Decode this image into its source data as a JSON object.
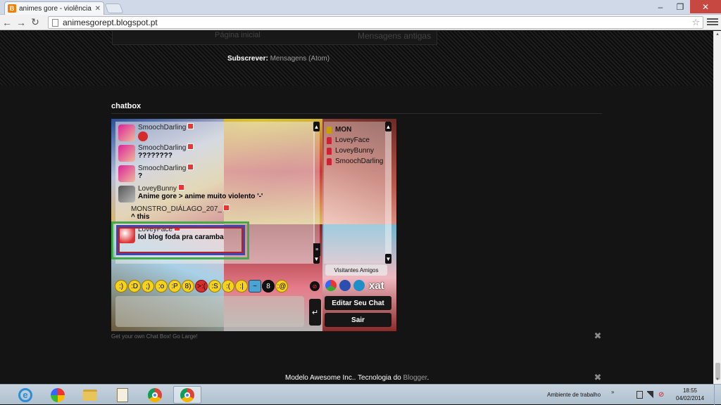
{
  "browser": {
    "tab_title": "animes gore - violência nã",
    "url": "animesgorept.blogspot.pt"
  },
  "blog": {
    "pager_older": "Página inicial",
    "pager_newer": "Mensagens antigas",
    "subscribe_label": "Subscrever:",
    "subscribe_link": "Mensagens (Atom)",
    "gadget_title": "chatbox",
    "chatbox_footer": "Get your own Chat Box! Go Large!",
    "footer_prefix": "Modelo Awesome Inc.. Tecnologia do ",
    "footer_link": "Blogger",
    "footer_suffix": "."
  },
  "chat": {
    "messages": [
      {
        "name": "SmoochDarling",
        "text": ""
      },
      {
        "name": "SmoochDarling",
        "text": "????????"
      },
      {
        "name": "SmoochDarling",
        "text": "?"
      },
      {
        "name": "LoveyBunny",
        "text": "Anime gore > anime muito violento '-'"
      },
      {
        "name": "MONSTRO_DIÁLAGO_207_",
        "text": "^ this"
      },
      {
        "name": "LoveyFace",
        "text": "lol blog foda pra caramba"
      }
    ],
    "users": [
      "MON",
      "LoveyFace",
      "LoveyBunny",
      "SmoochDarling"
    ],
    "tab_label": "Visitantes Amigos",
    "xat_logo": "xat",
    "edit_button": "Editar Seu Chat",
    "exit_button": "Sair",
    "smileys": [
      ":)",
      ":D",
      ";)",
      ":o",
      ":P",
      "8)",
      ">:(",
      ":S",
      ":(",
      ":|",
      "~",
      "8",
      ":@"
    ]
  },
  "taskbar": {
    "tray_label": "Ambiente de trabalho",
    "time": "18:55",
    "date": "04/02/2014"
  },
  "colors": {
    "page_bg": "#141414",
    "highlight_outer": "#44a84c",
    "highlight_middle": "#3b46b7",
    "highlight_inner": "#b2222b"
  }
}
